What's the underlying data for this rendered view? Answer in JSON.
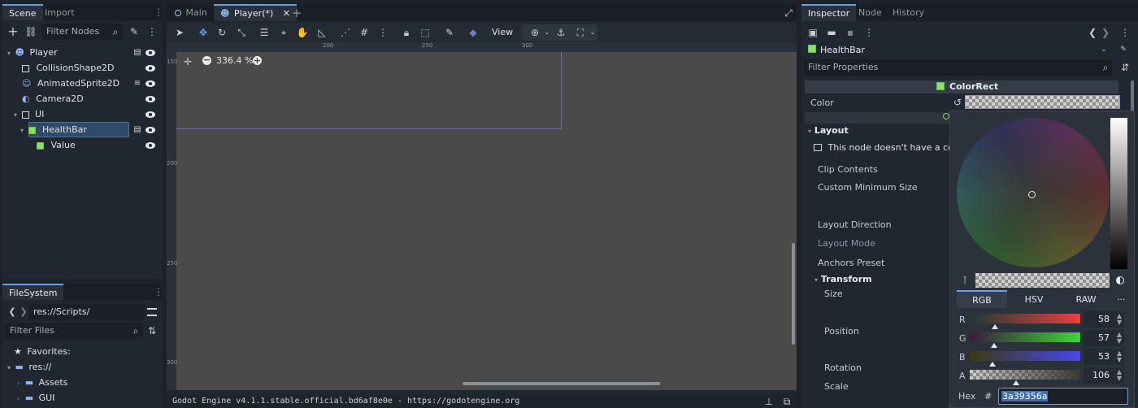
{
  "scene_dock": {
    "tabs": [
      "Scene",
      "Import"
    ],
    "filter_placeholder": "Filter Nodes",
    "tree": [
      {
        "label": "Player",
        "icon": "character-body-icon"
      },
      {
        "label": "CollisionShape2D",
        "icon": "collision-shape-icon"
      },
      {
        "label": "AnimatedSprite2D",
        "icon": "animated-sprite-icon"
      },
      {
        "label": "Camera2D",
        "icon": "camera-icon"
      },
      {
        "label": "UI",
        "icon": "control-icon"
      },
      {
        "label": "HealthBar",
        "icon": "color-rect-icon"
      },
      {
        "label": "Value",
        "icon": "color-rect-icon"
      }
    ]
  },
  "filesystem_dock": {
    "tab": "FileSystem",
    "path": "res://Scripts/",
    "filter_placeholder": "Filter Files",
    "items": [
      {
        "label": "Favorites:"
      },
      {
        "label": "res://"
      },
      {
        "label": "Assets"
      },
      {
        "label": "GUI"
      }
    ]
  },
  "editor_tabs": [
    {
      "label": "Main"
    },
    {
      "label": "Player(*)"
    }
  ],
  "toolbar": {
    "view_label": "View"
  },
  "viewport": {
    "zoom_label": "336.4 %",
    "ruler_h": [
      "200",
      "250",
      "300"
    ],
    "ruler_v": [
      "150",
      "200",
      "250",
      "300"
    ]
  },
  "output_bar": {
    "text": "Godot Engine v4.1.1.stable.official.bd6af8e0e - https://godotengine.org"
  },
  "inspector": {
    "tabs": [
      "Inspector",
      "Node",
      "History"
    ],
    "object_name": "HealthBar",
    "filter_placeholder": "Filter Properties",
    "class_name": "ColorRect",
    "color_label": "Color",
    "layout_section": "Layout",
    "warning_text": "This node doesn't have a contr",
    "props": [
      "Clip Contents",
      "Custom Minimum Size",
      "Layout Direction",
      "Layout Mode",
      "Anchors Preset"
    ],
    "transform_section": "Transform",
    "transform_props": [
      "Size",
      "Position",
      "Rotation",
      "Scale"
    ]
  },
  "color_picker": {
    "modes": [
      "RGB",
      "HSV",
      "RAW"
    ],
    "more_label": "...",
    "channels": [
      {
        "label": "R",
        "value": "58",
        "fraction": 0.227
      },
      {
        "label": "G",
        "value": "57",
        "fraction": 0.224
      },
      {
        "label": "B",
        "value": "53",
        "fraction": 0.208
      },
      {
        "label": "A",
        "value": "106",
        "fraction": 0.416
      }
    ],
    "hex_label": "Hex",
    "hash_label": "#",
    "hex_value": "3a39356a",
    "colors": {
      "r": "#e8403f",
      "g": "#3fd43c",
      "b": "#4a47e6"
    }
  }
}
